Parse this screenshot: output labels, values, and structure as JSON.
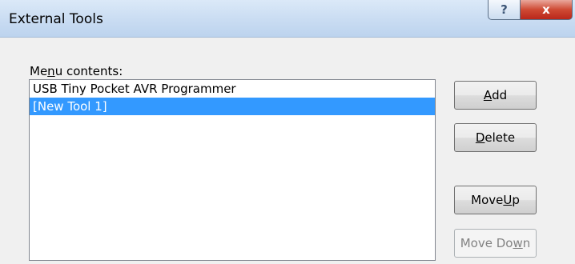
{
  "window": {
    "title": "External Tools",
    "help_glyph": "?",
    "close_glyph": "x"
  },
  "menu_contents": {
    "label_before": "Me",
    "label_mnemonic": "n",
    "label_after": "u contents:",
    "items": [
      {
        "label": "USB Tiny Pocket AVR Programmer",
        "selected": false
      },
      {
        "label": "[New Tool 1]",
        "selected": true
      }
    ]
  },
  "buttons": {
    "add": {
      "mnemonic": "A",
      "rest": "dd"
    },
    "delete": {
      "mnemonic": "D",
      "rest": "elete"
    },
    "move_up": {
      "before": "Move ",
      "mnemonic": "U",
      "rest": "p"
    },
    "move_down": {
      "before": "Move Do",
      "mnemonic": "w",
      "rest": "n",
      "enabled": false
    }
  },
  "colors": {
    "selection": "#3399ff",
    "close_button": "#c9452f"
  }
}
